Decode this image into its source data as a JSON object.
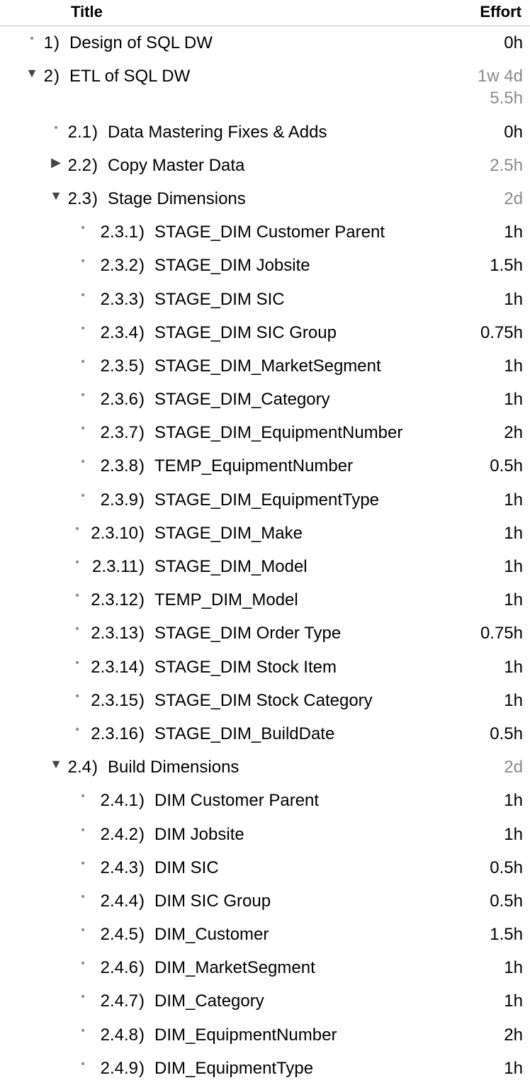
{
  "columns": {
    "title": "Title",
    "effort": "Effort"
  },
  "rows": [
    {
      "level": "lv0",
      "marker": "dot",
      "num": "1",
      "title": "Design of SQL DW",
      "effort": "0h",
      "rollup": false
    },
    {
      "level": "lv0",
      "marker": "down",
      "num": "2",
      "title": "ETL of SQL DW",
      "effort": "1w 4d\n5.5h",
      "rollup": true
    },
    {
      "level": "lv1",
      "marker": "dot",
      "num": "2.1",
      "title": "Data Mastering Fixes & Adds",
      "effort": "0h",
      "rollup": false
    },
    {
      "level": "lv1",
      "marker": "right",
      "num": "2.2",
      "title": "Copy Master Data",
      "effort": "2.5h",
      "rollup": true
    },
    {
      "level": "lv1",
      "marker": "down",
      "num": "2.3",
      "title": "Stage Dimensions",
      "effort": "2d",
      "rollup": true
    },
    {
      "level": "lv2",
      "marker": "dot",
      "num": "2.3.1",
      "title": "STAGE_DIM Customer Parent",
      "effort": "1h",
      "rollup": false
    },
    {
      "level": "lv2",
      "marker": "dot",
      "num": "2.3.2",
      "title": "STAGE_DIM Jobsite",
      "effort": "1.5h",
      "rollup": false
    },
    {
      "level": "lv2",
      "marker": "dot",
      "num": "2.3.3",
      "title": "STAGE_DIM SIC",
      "effort": "1h",
      "rollup": false
    },
    {
      "level": "lv2",
      "marker": "dot",
      "num": "2.3.4",
      "title": "STAGE_DIM SIC Group",
      "effort": "0.75h",
      "rollup": false
    },
    {
      "level": "lv2",
      "marker": "dot",
      "num": "2.3.5",
      "title": "STAGE_DIM_MarketSegment",
      "effort": "1h",
      "rollup": false
    },
    {
      "level": "lv2",
      "marker": "dot",
      "num": "2.3.6",
      "title": "STAGE_DIM_Category",
      "effort": "1h",
      "rollup": false
    },
    {
      "level": "lv2",
      "marker": "dot",
      "num": "2.3.7",
      "title": "STAGE_DIM_EquipmentNumber",
      "effort": "2h",
      "rollup": false
    },
    {
      "level": "lv2",
      "marker": "dot",
      "num": "2.3.8",
      "title": "TEMP_EquipmentNumber",
      "effort": "0.5h",
      "rollup": false
    },
    {
      "level": "lv2",
      "marker": "dot",
      "num": "2.3.9",
      "title": "STAGE_DIM_EquipmentType",
      "effort": "1h",
      "rollup": false
    },
    {
      "level": "lv2b",
      "marker": "dot",
      "num": "2.3.10",
      "title": "STAGE_DIM_Make",
      "effort": "1h",
      "rollup": false
    },
    {
      "level": "lv2b",
      "marker": "dot",
      "num": "2.3.11",
      "title": "STAGE_DIM_Model",
      "effort": "1h",
      "rollup": false
    },
    {
      "level": "lv2b",
      "marker": "dot",
      "num": "2.3.12",
      "title": "TEMP_DIM_Model",
      "effort": "1h",
      "rollup": false
    },
    {
      "level": "lv2b",
      "marker": "dot",
      "num": "2.3.13",
      "title": "STAGE_DIM Order Type",
      "effort": "0.75h",
      "rollup": false
    },
    {
      "level": "lv2b",
      "marker": "dot",
      "num": "2.3.14",
      "title": "STAGE_DIM Stock Item",
      "effort": "1h",
      "rollup": false
    },
    {
      "level": "lv2b",
      "marker": "dot",
      "num": "2.3.15",
      "title": "STAGE_DIM Stock Category",
      "effort": "1h",
      "rollup": false
    },
    {
      "level": "lv2b",
      "marker": "dot",
      "num": "2.3.16",
      "title": "STAGE_DIM_BuildDate",
      "effort": "0.5h",
      "rollup": false
    },
    {
      "level": "lv1",
      "marker": "down",
      "num": "2.4",
      "title": "Build Dimensions",
      "effort": "2d",
      "rollup": true
    },
    {
      "level": "lv2",
      "marker": "dot",
      "num": "2.4.1",
      "title": "DIM Customer Parent",
      "effort": "1h",
      "rollup": false
    },
    {
      "level": "lv2",
      "marker": "dot",
      "num": "2.4.2",
      "title": "DIM Jobsite",
      "effort": "1h",
      "rollup": false
    },
    {
      "level": "lv2",
      "marker": "dot",
      "num": "2.4.3",
      "title": "DIM SIC",
      "effort": "0.5h",
      "rollup": false
    },
    {
      "level": "lv2",
      "marker": "dot",
      "num": "2.4.4",
      "title": "DIM SIC Group",
      "effort": "0.5h",
      "rollup": false
    },
    {
      "level": "lv2",
      "marker": "dot",
      "num": "2.4.5",
      "title": "DIM_Customer",
      "effort": "1.5h",
      "rollup": false
    },
    {
      "level": "lv2",
      "marker": "dot",
      "num": "2.4.6",
      "title": "DIM_MarketSegment",
      "effort": "1h",
      "rollup": false
    },
    {
      "level": "lv2",
      "marker": "dot",
      "num": "2.4.7",
      "title": "DIM_Category",
      "effort": "1h",
      "rollup": false
    },
    {
      "level": "lv2",
      "marker": "dot",
      "num": "2.4.8",
      "title": "DIM_EquipmentNumber",
      "effort": "2h",
      "rollup": false
    },
    {
      "level": "lv2",
      "marker": "dot",
      "num": "2.4.9",
      "title": "DIM_EquipmentType",
      "effort": "1h",
      "rollup": false
    }
  ]
}
